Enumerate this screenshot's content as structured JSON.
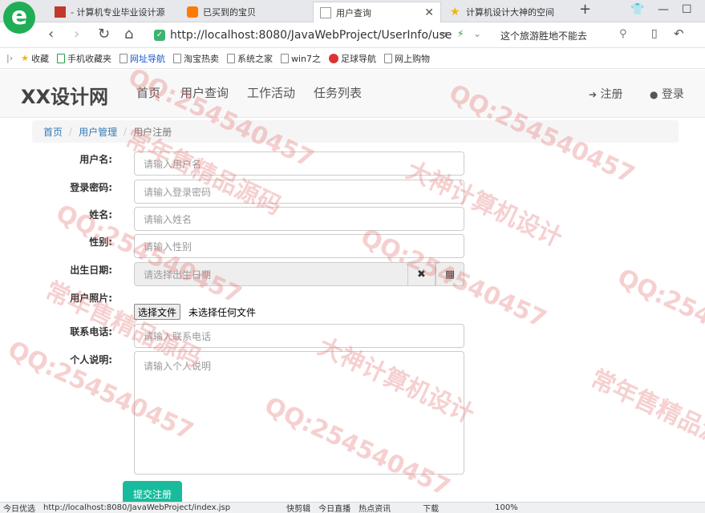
{
  "browser": {
    "tabs": [
      {
        "label": "- 计算机专业毕业设计源"
      },
      {
        "label": "已买到的宝贝"
      },
      {
        "label": "用户查询"
      },
      {
        "label": "计算机设计大神的空间"
      }
    ],
    "address": "http://localhost:8080/JavaWebProject/UserInfo/use",
    "search_text": "这个旅游胜地不能去",
    "bookmarks": [
      "收藏",
      "手机收藏夹",
      "网址导航",
      "淘宝热卖",
      "系统之家",
      "win7之",
      "足球导航",
      "网上购物"
    ]
  },
  "site": {
    "brand": "XX设计网",
    "menu": [
      "首页",
      "用户查询",
      "工作活动",
      "任务列表"
    ],
    "register": "注册",
    "login": "登录"
  },
  "breadcrumb": {
    "home": "首页",
    "section": "用户管理",
    "current": "用户注册"
  },
  "form": {
    "username_label": "用户名:",
    "username_placeholder": "请输入用户名",
    "password_label": "登录密码:",
    "password_placeholder": "请输入登录密码",
    "name_label": "姓名:",
    "name_placeholder": "请输入姓名",
    "gender_label": "性别:",
    "gender_placeholder": "请输入性别",
    "birth_label": "出生日期:",
    "birth_placeholder": "请选择出生日期",
    "photo_label": "用户照片:",
    "file_button": "选择文件",
    "file_status": "未选择任何文件",
    "phone_label": "联系电话:",
    "phone_placeholder": "请输入联系电话",
    "bio_label": "个人说明:",
    "bio_placeholder": "请输入个人说明",
    "submit": "提交注册"
  },
  "statusbar": {
    "left": "今日优选",
    "url": "http://localhost:8080/JavaWebProject/index.jsp",
    "items": [
      "快剪辑",
      "今日直播",
      "热点资讯",
      "下载",
      "100%"
    ]
  },
  "watermarks": [
    "QQ:254540457",
    "大神计算机设计",
    "常年售精品源码"
  ],
  "colors": {
    "accent": "#18bc9c",
    "link": "#337ab7"
  }
}
